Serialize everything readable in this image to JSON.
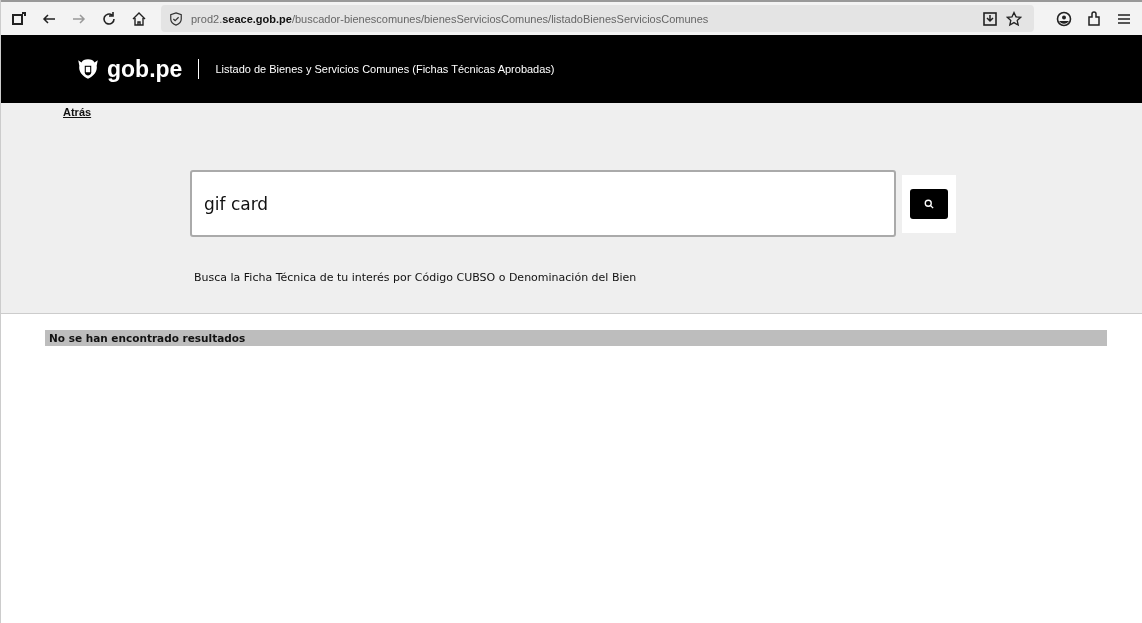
{
  "browser": {
    "url": "prod2.**seace.gob.pe**/buscador-bienescomunes/bienesServiciosComunes/listadoBienesServiciosComunes"
  },
  "header": {
    "logo_text": "gob.pe",
    "title": "Listado de Bienes y Servicios Comunes (Fichas Técnicas Aprobadas)"
  },
  "back_link": "Atrás",
  "search": {
    "value": "gif card"
  },
  "hint": "Busca la Ficha Técnica de tu interés por Código CUBSO o Denominación del Bien",
  "results_message": "No se han encontrado resultados"
}
